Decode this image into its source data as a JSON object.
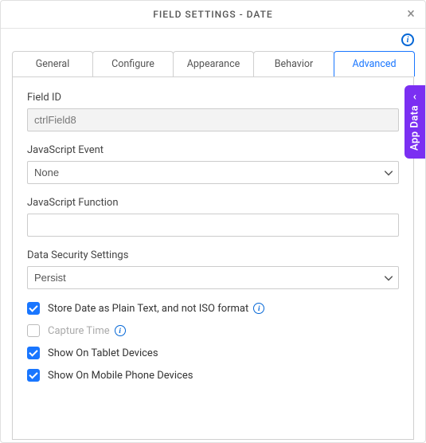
{
  "header": {
    "title": "FIELD SETTINGS - DATE"
  },
  "tabs": {
    "items": [
      {
        "label": "General"
      },
      {
        "label": "Configure"
      },
      {
        "label": "Appearance"
      },
      {
        "label": "Behavior"
      },
      {
        "label": "Advanced"
      }
    ]
  },
  "panel": {
    "field_id_label": "Field ID",
    "field_id_value": "ctrlField8",
    "js_event_label": "JavaScript Event",
    "js_event_value": "None",
    "js_function_label": "JavaScript Function",
    "js_function_value": "",
    "data_security_label": "Data Security Settings",
    "data_security_value": "Persist",
    "checkboxes": [
      {
        "label": "Store Date as Plain Text, and not ISO format",
        "checked": true,
        "disabled": false,
        "info": true
      },
      {
        "label": "Capture Time",
        "checked": false,
        "disabled": true,
        "info": true
      },
      {
        "label": "Show On Tablet Devices",
        "checked": true,
        "disabled": false,
        "info": false
      },
      {
        "label": "Show On Mobile Phone Devices",
        "checked": true,
        "disabled": false,
        "info": false
      }
    ]
  },
  "side_tab": {
    "label": "App Data"
  }
}
